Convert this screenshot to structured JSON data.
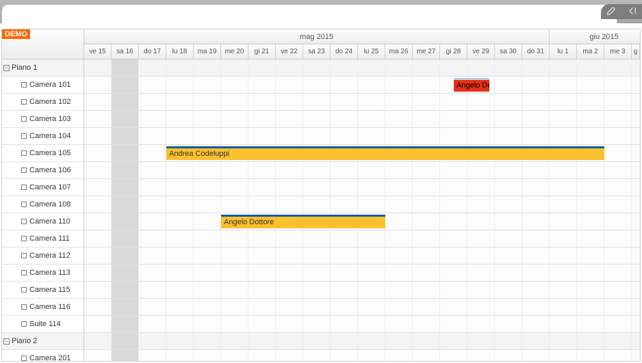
{
  "badge": "DEMO",
  "months": [
    {
      "label": "mag 2015",
      "span": 17
    },
    {
      "label": "giu 2015",
      "span": 4
    }
  ],
  "days": [
    "ve 15",
    "sa 16",
    "do 17",
    "lu 18",
    "ma 19",
    "me 20",
    "gi 21",
    "ve 22",
    "sa 23",
    "do 24",
    "lu 25",
    "ma 26",
    "me 27",
    "gi 28",
    "ve 29",
    "sa 30",
    "do 31",
    "lu 1",
    "ma 2",
    "me 3",
    "g"
  ],
  "today_index": 1,
  "resources": [
    {
      "label": "Piano 1",
      "type": "group"
    },
    {
      "label": "Camera 101",
      "type": "leaf"
    },
    {
      "label": "Camera 102",
      "type": "leaf"
    },
    {
      "label": "Camera 103",
      "type": "leaf"
    },
    {
      "label": "Camera 104",
      "type": "leaf"
    },
    {
      "label": "Camera 105",
      "type": "leaf"
    },
    {
      "label": "Camera 106",
      "type": "leaf"
    },
    {
      "label": "Camera 107",
      "type": "leaf"
    },
    {
      "label": "Camera 108",
      "type": "leaf"
    },
    {
      "label": "Camera 110",
      "type": "leaf"
    },
    {
      "label": "Camera 111",
      "type": "leaf"
    },
    {
      "label": "Camera 112",
      "type": "leaf"
    },
    {
      "label": "Camera 113",
      "type": "leaf"
    },
    {
      "label": "Camera 115",
      "type": "leaf"
    },
    {
      "label": "Camera 116",
      "type": "leaf"
    },
    {
      "label": "Suite 114",
      "type": "leaf"
    },
    {
      "label": "Piano 2",
      "type": "group"
    },
    {
      "label": "Camera 201",
      "type": "leaf"
    }
  ],
  "events": [
    {
      "row": 1,
      "start": 13.5,
      "span": 1.3,
      "label": "Angelo Dottore",
      "color": "red"
    },
    {
      "row": 5,
      "start": 3,
      "span": 16,
      "label": "Andrea Codeluppi",
      "color": "yellow"
    },
    {
      "row": 9,
      "start": 5,
      "span": 6,
      "label": "Angelo Dottore",
      "color": "yellow"
    }
  ],
  "icons": {
    "edit": "edit",
    "collapse": "collapse"
  },
  "colors": {
    "accent_orange": "#ff6600",
    "event_yellow": "#fbc02d",
    "event_red": "#e53016",
    "event_border_blue": "#0d5aa7"
  }
}
